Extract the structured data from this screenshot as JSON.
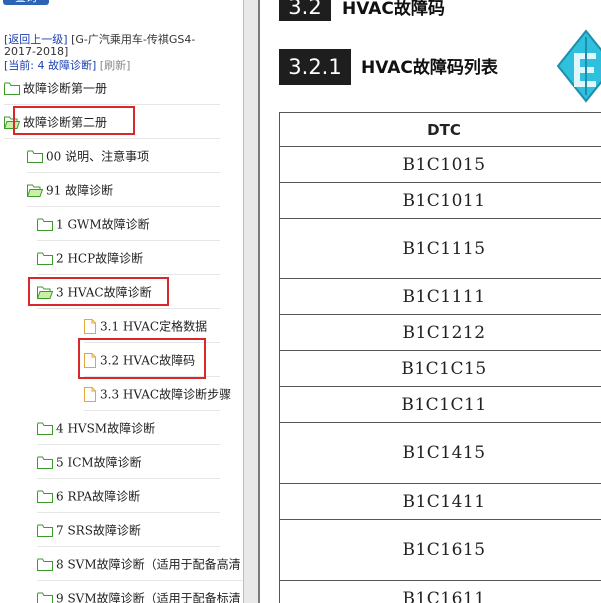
{
  "nav": {
    "query_button": "查询",
    "back_link": "[返回上一级]",
    "book_title": "[G-广汽乘用车-传祺GS4-",
    "book_years": "2017-2018]",
    "current_prefix": "[当前:",
    "current_value": "4 故障诊断]",
    "refresh": "[刷新]"
  },
  "tree": [
    {
      "label": "故障诊断第一册"
    },
    {
      "label": "故障诊断第二册"
    },
    {
      "label": "00 说明、注意事项"
    },
    {
      "label": "91 故障诊断"
    },
    {
      "label": "1 GWM故障诊断"
    },
    {
      "label": "2 HCP故障诊断"
    },
    {
      "label": "3 HVAC故障诊断"
    },
    {
      "label": "3.1 HVAC定格数据"
    },
    {
      "label": "3.2 HVAC故障码"
    },
    {
      "label": "3.3 HVAC故障诊断步骤"
    },
    {
      "label": "4 HVSM故障诊断"
    },
    {
      "label": "5 ICM故障诊断"
    },
    {
      "label": "6 RPA故障诊断"
    },
    {
      "label": "7 SRS故障诊断"
    },
    {
      "label": "8 SVM故障诊断（适用于配备高清"
    },
    {
      "label": "9 SVM故障诊断（适用于配备标清"
    }
  ],
  "doc": {
    "section_num": "3.2",
    "section_title": "HVAC故障码",
    "subsection_num": "3.2.1",
    "subsection_title": "HVAC故障码列表",
    "table_header": "DTC",
    "rows": [
      {
        "code": "B1C1015"
      },
      {
        "code": "B1C1011"
      },
      {
        "code": "B1C1115"
      },
      {
        "code": "B1C1111"
      },
      {
        "code": "B1C1212"
      },
      {
        "code": "B1C1C15"
      },
      {
        "code": "B1C1C11"
      },
      {
        "code": "B1C1415"
      },
      {
        "code": "B1C1411"
      },
      {
        "code": "B1C1615"
      },
      {
        "code": "B1C1611"
      }
    ]
  },
  "icons": {
    "folder": "folder-icon",
    "open_folder": "folder-open-icon",
    "document": "document-icon",
    "logo": "logo-icon"
  },
  "colors": {
    "highlight": "#d8282b",
    "link": "#1a3fb0",
    "folder_stroke": "#3c9a2a",
    "folder_fill": "#c9f0a4",
    "doc_stroke": "#e2a83a",
    "section_bg": "#1e1e1e",
    "logo": "#27b8d6"
  }
}
